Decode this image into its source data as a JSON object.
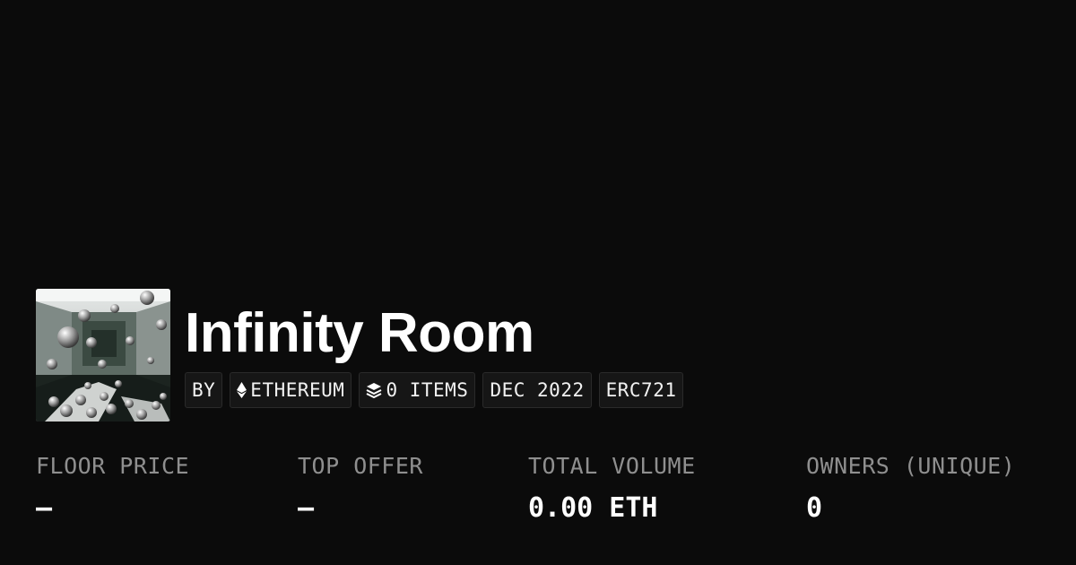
{
  "collection": {
    "name": "Infinity Room",
    "thumbnail_icon": "infinity-room-artwork-image"
  },
  "badges": {
    "by": "BY",
    "chain": "ETHEREUM",
    "chain_icon": "ethereum-icon",
    "items": "0 ITEMS",
    "items_icon": "layers-icon",
    "date": "DEC 2022",
    "standard": "ERC721"
  },
  "stats": {
    "floor_price": {
      "label": "FLOOR PRICE",
      "value": "–"
    },
    "top_offer": {
      "label": "TOP OFFER",
      "value": "–"
    },
    "total_volume": {
      "label": "TOTAL VOLUME",
      "value": "0.00 ETH"
    },
    "owners": {
      "label": "OWNERS (UNIQUE)",
      "value": "0"
    }
  },
  "colors": {
    "background": "#0b0b0b",
    "badge_background": "#161616",
    "label_gray": "#8f8f8f",
    "text_white": "#ffffff"
  }
}
